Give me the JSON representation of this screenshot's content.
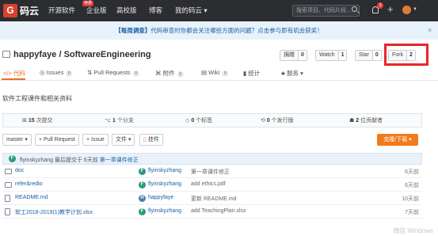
{
  "colors": {
    "nav_bg": "#2c2d31",
    "brand": "#d9412b",
    "accent": "#e8702a",
    "link": "#1a5ea6",
    "highlight": "#e8262a"
  },
  "topnav": {
    "logo_mark": "G",
    "logo_text": "码云",
    "items": [
      "开源软件",
      "企业版",
      "高校版",
      "博客",
      "我的码云 ▾"
    ],
    "special_badge": "特惠",
    "search_placeholder": "搜索项目、代码片段...",
    "notif_count": "3"
  },
  "announcement": {
    "tag": "【每周调查】",
    "text": "代码审查时你都会关注哪些方面的问题？点击参与即有机会获奖！",
    "close": "✕"
  },
  "repo": {
    "title": "happyfaye / SoftwareEngineering",
    "actions": [
      {
        "label": "捐赠",
        "count": "0"
      },
      {
        "label": "Watch",
        "count": "1"
      },
      {
        "label": "Star",
        "count": "0"
      },
      {
        "label": "Fork",
        "count": "2"
      }
    ]
  },
  "tabs": [
    {
      "label": "代码",
      "count": ""
    },
    {
      "label": "Issues",
      "count": "0"
    },
    {
      "label": "Pull Requests",
      "count": "0"
    },
    {
      "label": "附件",
      "count": "0"
    },
    {
      "label": "Wiki",
      "count": "0"
    },
    {
      "label": "统计",
      "count": ""
    },
    {
      "label": "服务 ▾",
      "count": ""
    }
  ],
  "description": "软件工程课件和相关资料",
  "stats": {
    "commits": "15",
    "commits_label": "次提交",
    "branches": "1",
    "branches_label": "个分支",
    "tags": "0",
    "tags_label": "个标签",
    "releases": "0",
    "releases_label": "个发行版",
    "contributors": "2",
    "contributors_label": "位贡献者"
  },
  "toolbar": {
    "branch": "master ▾",
    "pull_request": "+ Pull Request",
    "issue": "+ Issue",
    "file": "文件 ▾",
    "pin": "挂件",
    "clone": "克隆/下载 ▾"
  },
  "commit": {
    "avatar": "F",
    "author": "flyinskyzhang",
    "mid": "最后提交于 6天前",
    "message": "第一章课件修正"
  },
  "files": [
    {
      "name": "doc",
      "type": "dir",
      "avatar": "F",
      "author": "flyinskyzhang",
      "message": "第一章课件修正",
      "age": "6天前"
    },
    {
      "name": "refer&redio",
      "type": "dir",
      "avatar": "F",
      "author": "flyinskyzhang",
      "message": "add ethics.pdf",
      "age": "6天前"
    },
    {
      "name": "README.md",
      "type": "file",
      "avatar": "H",
      "author": "happyfaye",
      "message": "更新 README.md",
      "age": "10天前"
    },
    {
      "name": "软工2018-2019(1)教学计划.xlsx",
      "type": "file",
      "avatar": "F",
      "author": "flyinskyzhang",
      "message": "add TeachingPlan.xlsx",
      "age": "7天前"
    }
  ],
  "watermark": "微信 Windows"
}
